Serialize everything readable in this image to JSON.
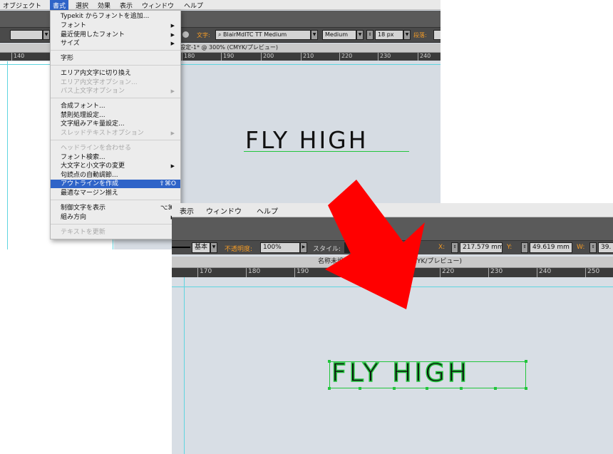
{
  "shot1": {
    "menubar": [
      "オブジェクト",
      "書式",
      "選択",
      "効果",
      "表示",
      "ウィンドウ",
      "ヘルプ"
    ],
    "control": {
      "font_label": "文字:",
      "font_value": "BlairMdITC TT Medium",
      "style_value": "Medium",
      "size_value": "18 px",
      "para_label": "段落:"
    },
    "doc_title": "名称未設定-1* @ 300% (CMYK/プレビュー)",
    "ruler": [
      "140",
      "180",
      "190",
      "200",
      "210",
      "220",
      "230",
      "240"
    ],
    "menu": [
      {
        "label": "Typekit からフォントを追加...",
        "disabled": false
      },
      {
        "label": "フォント",
        "sub": true
      },
      {
        "label": "最近使用したフォント",
        "sub": true
      },
      {
        "label": "サイズ",
        "sub": true
      },
      {
        "sep": true
      },
      {
        "label": "字形"
      },
      {
        "sep": true
      },
      {
        "label": "エリア内文字に切り換え"
      },
      {
        "label": "エリア内文字オプション...",
        "disabled": true
      },
      {
        "label": "パス上文字オプション",
        "disabled": true,
        "sub": true
      },
      {
        "sep": true
      },
      {
        "label": "合成フォント..."
      },
      {
        "label": "禁則処理設定..."
      },
      {
        "label": "文字組みアキ量設定..."
      },
      {
        "label": "スレッドテキストオプション",
        "disabled": true,
        "sub": true
      },
      {
        "sep": true
      },
      {
        "label": "ヘッドラインを合わせる",
        "disabled": true
      },
      {
        "label": "フォント検索..."
      },
      {
        "label": "大文字と小文字の変更",
        "sub": true
      },
      {
        "label": "句読点の自動調節..."
      },
      {
        "label": "アウトラインを作成",
        "selected": true,
        "shortcut": "⇧⌘O"
      },
      {
        "label": "最適なマージン揃え"
      },
      {
        "sep": true
      },
      {
        "label": "制御文字を表示",
        "shortcut": "⌥⌘I"
      },
      {
        "label": "組み方向",
        "sub": true
      },
      {
        "sep": true
      },
      {
        "label": "テキストを更新",
        "disabled": true
      }
    ],
    "artwork_text": "FLY HIGH"
  },
  "shot2": {
    "menubar": [
      "表示",
      "ウィンドウ",
      "ヘルプ"
    ],
    "control": {
      "stroke_value": "基本",
      "opacity_label": "不透明度:",
      "opacity_value": "100%",
      "style_label": "スタイル:",
      "x_label": "X:",
      "x_value": "217.579 mm",
      "y_label": "Y:",
      "y_value": "49.619 mm",
      "w_label": "W:",
      "w_value": "39."
    },
    "doc_title_left": "名称未設定",
    "doc_title_right": "CMYK/プレビュー)",
    "ruler": [
      "170",
      "180",
      "190",
      "200",
      "210",
      "220",
      "230",
      "240",
      "250"
    ],
    "artwork_text": "FLY HIGH"
  },
  "colors": {
    "arrow": "#ff0000",
    "selection": "#22c53c",
    "guide": "#5fd5e0",
    "menu_highlight": "#2f64c8"
  }
}
